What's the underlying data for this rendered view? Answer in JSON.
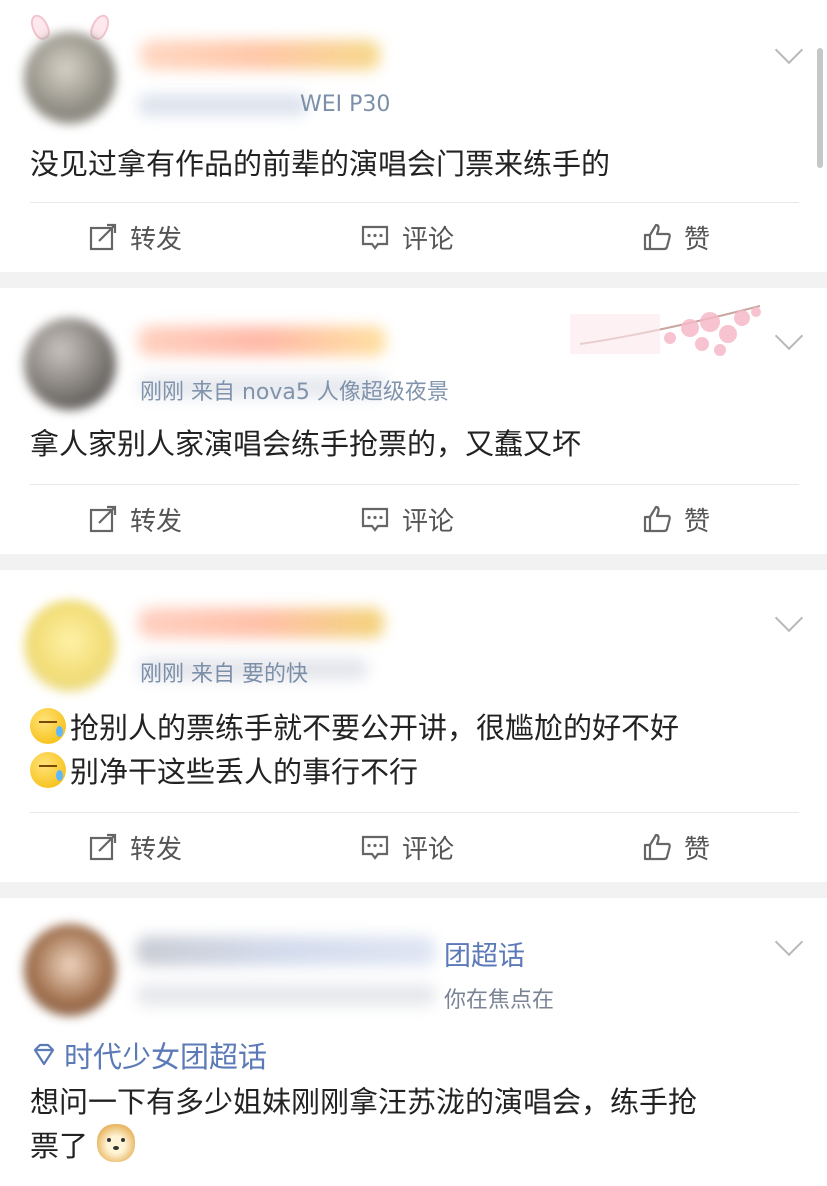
{
  "posts": [
    {
      "meta_tail": "WEI P30",
      "text": "没见过拿有作品的前辈的演唱会门票来练手的"
    },
    {
      "meta_tail": "刚刚  来自 nova5 人像超级夜景",
      "text": "拿人家别人家演唱会练手抢票的，又蠢又坏"
    },
    {
      "meta_tail": "刚刚  来自 要的快",
      "line1": "抢别人的票练手就不要公开讲，很尴尬的好不好",
      "line2": "别净干这些丢人的事行不行"
    },
    {
      "name_tail": "团超话",
      "meta_tail": "你在焦点在",
      "topic": "时代少女团超话",
      "line1": "想问一下有多少姐妹刚刚拿汪苏泷的演唱会，练手抢",
      "line2": "票了"
    }
  ],
  "actions": {
    "repost": "转发",
    "comment": "评论",
    "like": "赞"
  },
  "icons": {
    "repost": "repost-icon",
    "comment": "comment-icon",
    "like": "thumbs-up-icon",
    "more": "chevron-down-icon",
    "topic": "diamond-icon",
    "emoji_sweat": "sweat-emoji-icon",
    "emoji_doge": "doge-emoji-icon"
  },
  "colors": {
    "link": "#5b7ab7",
    "meta": "#7b8fa8",
    "text": "#222222",
    "background": "#f2f2f2"
  }
}
